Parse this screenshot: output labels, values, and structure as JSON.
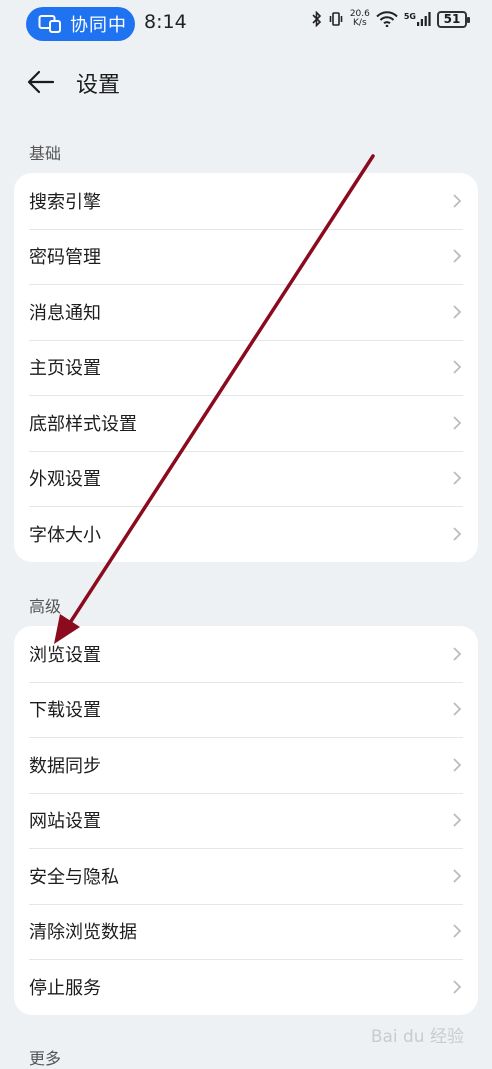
{
  "status_bar": {
    "collab_label": "协同中",
    "time": "8:14",
    "net_speed_value": "20.6",
    "net_speed_unit": "K/s",
    "network_type": "5G",
    "battery": "51"
  },
  "header": {
    "title": "设置"
  },
  "sections": {
    "basic": {
      "title": "基础",
      "items": [
        "搜索引擎",
        "密码管理",
        "消息通知",
        "主页设置",
        "底部样式设置",
        "外观设置",
        "字体大小"
      ]
    },
    "advanced": {
      "title": "高级",
      "items": [
        "浏览设置",
        "下载设置",
        "数据同步",
        "网站设置",
        "安全与隐私",
        "清除浏览数据",
        "停止服务"
      ]
    },
    "more": {
      "title": "更多"
    }
  },
  "annotation": {
    "arrow_color": "#8b0a1e"
  },
  "watermark": {
    "text": "Bai du 经验"
  },
  "colors": {
    "accent": "#1f73f0",
    "background": "#eef1f3",
    "card": "#ffffff"
  }
}
